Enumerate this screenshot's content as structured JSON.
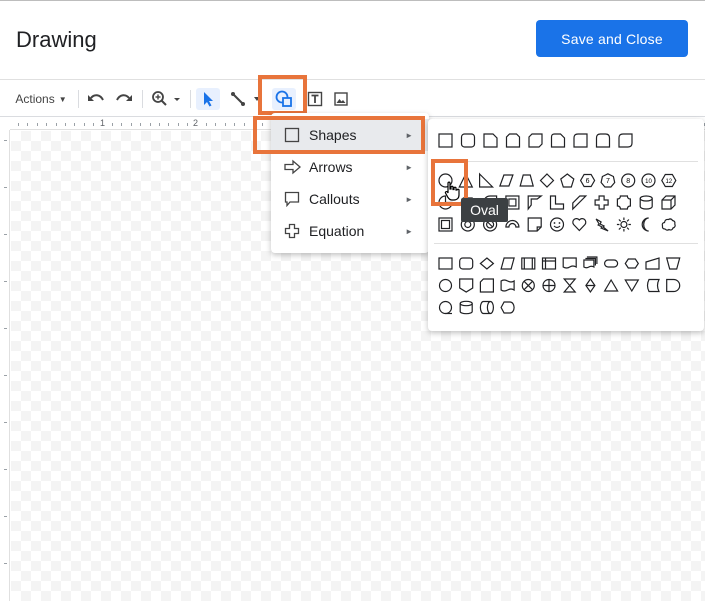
{
  "header": {
    "title": "Drawing",
    "save_label": "Save and Close"
  },
  "toolbar": {
    "actions_label": "Actions",
    "buttons": [
      "undo-icon",
      "redo-icon",
      "zoom-icon",
      "select-icon",
      "line-icon",
      "shape-icon",
      "text-box-icon",
      "image-icon"
    ],
    "active": "shape-icon"
  },
  "ruler": {
    "marks": [
      "1",
      "2"
    ]
  },
  "menu": {
    "items": [
      {
        "label": "Shapes",
        "icon": "square-icon",
        "selected": true
      },
      {
        "label": "Arrows",
        "icon": "arrow-icon",
        "selected": false
      },
      {
        "label": "Callouts",
        "icon": "callout-icon",
        "selected": false
      },
      {
        "label": "Equation",
        "icon": "plus-icon",
        "selected": false
      }
    ],
    "submenu_arrow": "►"
  },
  "shapes_panel": {
    "sections": [
      "shapes",
      "flowchart"
    ],
    "hovered_shape": "oval"
  },
  "tooltip": {
    "text": "Oval"
  },
  "colors": {
    "accent": "#1a73e8",
    "highlight": "#e8743b",
    "tooltip_bg": "#3c4043"
  }
}
